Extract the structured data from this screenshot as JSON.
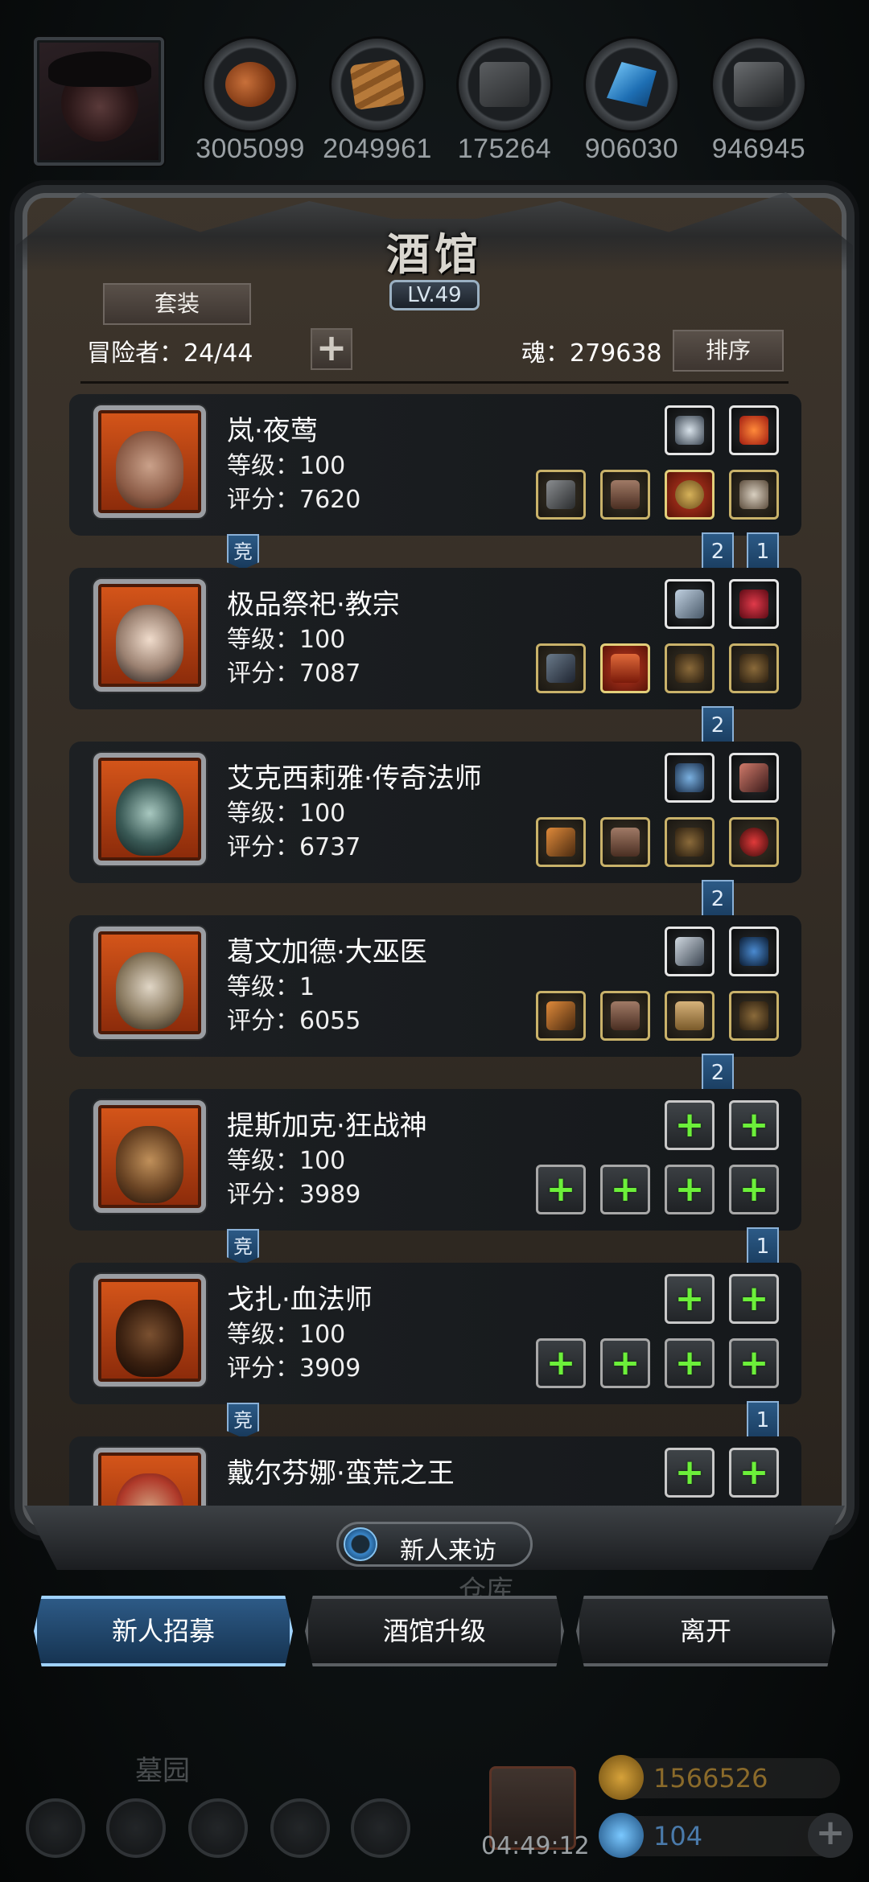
{
  "resources": [
    {
      "icon": "meat-icon",
      "value": "3005099"
    },
    {
      "icon": "wood-icon",
      "value": "2049961"
    },
    {
      "icon": "iron-icon",
      "value": "175264"
    },
    {
      "icon": "crystal-icon",
      "value": "906030"
    },
    {
      "icon": "stone-icon",
      "value": "946945"
    }
  ],
  "panel": {
    "title": "酒馆",
    "level": "LV.49",
    "suit_label": "套装",
    "adventurers_label": "冒险者：24/44",
    "soul_label": "魂：279638",
    "sort_label": "排序"
  },
  "heroes": [
    {
      "name": "岚·夜莺",
      "level": "等级：100",
      "score": "评分：7620",
      "comp": "竞",
      "tags": [
        "2",
        "1"
      ],
      "empty_slots": false
    },
    {
      "name": "极品祭祀·教宗",
      "level": "等级：100",
      "score": "评分：7087",
      "comp": "",
      "tags": [
        "2"
      ],
      "empty_slots": false
    },
    {
      "name": "艾克西莉雅·传奇法师",
      "level": "等级：100",
      "score": "评分：6737",
      "comp": "",
      "tags": [
        "2"
      ],
      "empty_slots": false
    },
    {
      "name": "葛文加德·大巫医",
      "level": "等级：1",
      "score": "评分：6055",
      "comp": "",
      "tags": [
        "2"
      ],
      "empty_slots": false
    },
    {
      "name": "提斯加克·狂战神",
      "level": "等级：100",
      "score": "评分：3989",
      "comp": "竞",
      "tags": [
        "1"
      ],
      "empty_slots": true
    },
    {
      "name": "戈扎·血法师",
      "level": "等级：100",
      "score": "评分：3909",
      "comp": "竞",
      "tags": [
        "1"
      ],
      "empty_slots": true
    },
    {
      "name": "戴尔芬娜·蛮荒之王",
      "level": "",
      "score": "",
      "comp": "",
      "tags": [],
      "empty_slots": true
    }
  ],
  "footer": {
    "visit_label": "新人来访",
    "recruit_label": "新人招募",
    "upgrade_label": "酒馆升级",
    "leave_label": "离开"
  },
  "background": {
    "warehouse_label": "仓库",
    "graveyard_label": "墓园",
    "timer": "04:49:12",
    "gold_value": "1566526",
    "gem_value": "104"
  },
  "colors": {
    "accent_blue": "#2d5a86",
    "equip_border": "#c9b26a",
    "plus_green": "#6cf03a",
    "portrait_orange": "#d6561a"
  }
}
